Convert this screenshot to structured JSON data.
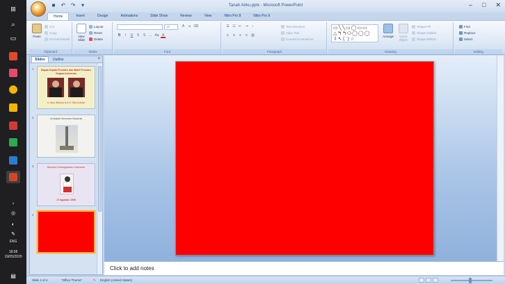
{
  "window": {
    "title": "Tanah Airku.pptx - Microsoft PowerPoint",
    "controls": {
      "minimize": "–",
      "maximize": "□",
      "close": "✕"
    }
  },
  "quick_access": {
    "icons": [
      "save-icon",
      "undo-icon",
      "redo-icon",
      "customize-icon"
    ]
  },
  "ribbon": {
    "tabs": [
      "Home",
      "Insert",
      "Design",
      "Animations",
      "Slide Show",
      "Review",
      "View",
      "Nitro Pro 8",
      "Nitro Pro 9"
    ],
    "active_tab": "Home",
    "groups": {
      "clipboard": {
        "label": "Clipboard",
        "paste": "Paste",
        "cut": "Cut",
        "copy": "Copy",
        "format_painter": "Format Painter"
      },
      "slides": {
        "label": "Slides",
        "new_slide": "New Slide",
        "layout": "Layout",
        "reset": "Reset",
        "delete": "Delete"
      },
      "font": {
        "label": "Font",
        "size": "18"
      },
      "paragraph": {
        "label": "Paragraph",
        "text_direction": "Text Direction",
        "align_text": "Align Text",
        "convert_smartart": "Convert to SmartArt"
      },
      "drawing": {
        "label": "Drawing",
        "arrange": "Arrange",
        "quick_styles": "Quick Styles",
        "shape_fill": "Shape Fill",
        "shape_outline": "Shape Outline",
        "shape_effects": "Shape Effects"
      },
      "editing": {
        "label": "Editing",
        "find": "Find",
        "replace": "Replace",
        "select": "Select"
      }
    }
  },
  "slides_pane": {
    "tabs": [
      "Slides",
      "Outline"
    ],
    "active_tab": "Slides",
    "close": "×",
    "slides": [
      {
        "number": "1",
        "line1": "Bapak Kepala Presiden dan Wakil Presiden Negara Indonesia",
        "caption": "Ir. Joko Widodo & K.H. Ma'ruf Amin",
        "background": "#f3f0c8"
      },
      {
        "number": "2",
        "line1": "Ini adalah Monumen Nasional",
        "caption": "",
        "background": "#f2f2ee"
      },
      {
        "number": "3",
        "line1": "Bendera Kebangsaanku Indonesia",
        "caption": "17 Agustus 1945",
        "background": "#e9e4f2"
      },
      {
        "number": "4",
        "line1": "",
        "caption": "",
        "background": "#ff0000"
      }
    ]
  },
  "main_slide": {
    "background": "#ff0000"
  },
  "notes": {
    "placeholder": "Click to add notes"
  },
  "status": {
    "slide_info": "Slide 4 of 4",
    "theme": "\"Office Theme\"",
    "language": "English (United States)"
  },
  "taskbar": {
    "time": "18:58",
    "date": "19/05/2020",
    "language": "ENG",
    "app_colors": [
      "#e0492b",
      "#e84a6a",
      "#f4b400",
      "#d33a2f",
      "#2fa84f",
      "#2b7cd3",
      "#d24726"
    ]
  },
  "colors": {
    "ribbon_accent": "#15428b",
    "slide_red": "#ff0000",
    "selected_border": "#f0b04a"
  }
}
